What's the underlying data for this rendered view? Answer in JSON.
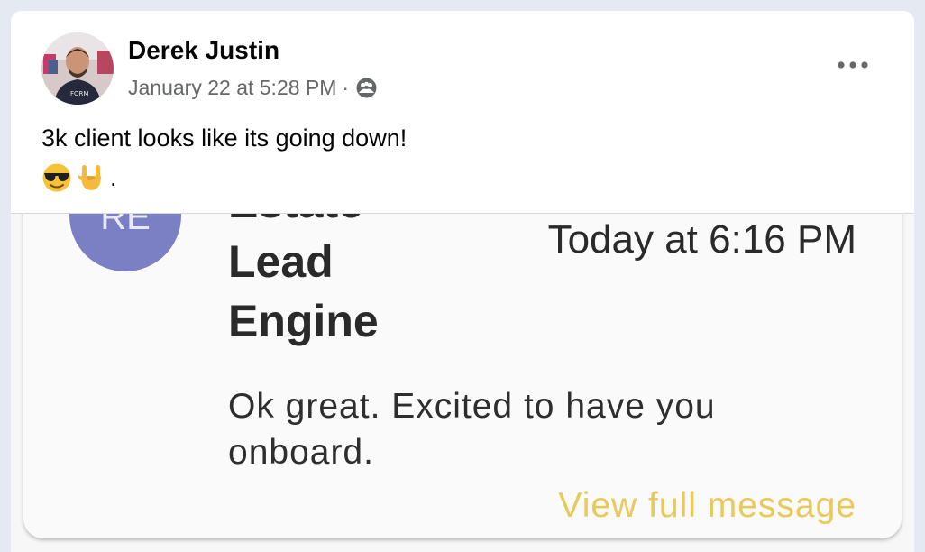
{
  "post": {
    "author_name": "Derek Justin",
    "timestamp": "January 22 at 5:28 PM",
    "separator": "·",
    "audience_icon": "friends-icon",
    "more_icon": "more-options-icon",
    "caption": "3k client looks like its going down!",
    "emojis": [
      "smiling-face-with-sunglasses-emoji",
      "sign-of-the-horns-emoji"
    ],
    "trailing_text": "."
  },
  "screenshot": {
    "sender_initials": "RE",
    "sender_name_lines": [
      "Estate",
      "Lead",
      "Engine"
    ],
    "message_time": "Today at 6:16 PM",
    "message_text": "Ok great. Excited to have you onboard.",
    "view_full_label": "View full message",
    "colors": {
      "avatar_bg": "#7b7fc4",
      "link_color": "#e8c95a"
    }
  }
}
